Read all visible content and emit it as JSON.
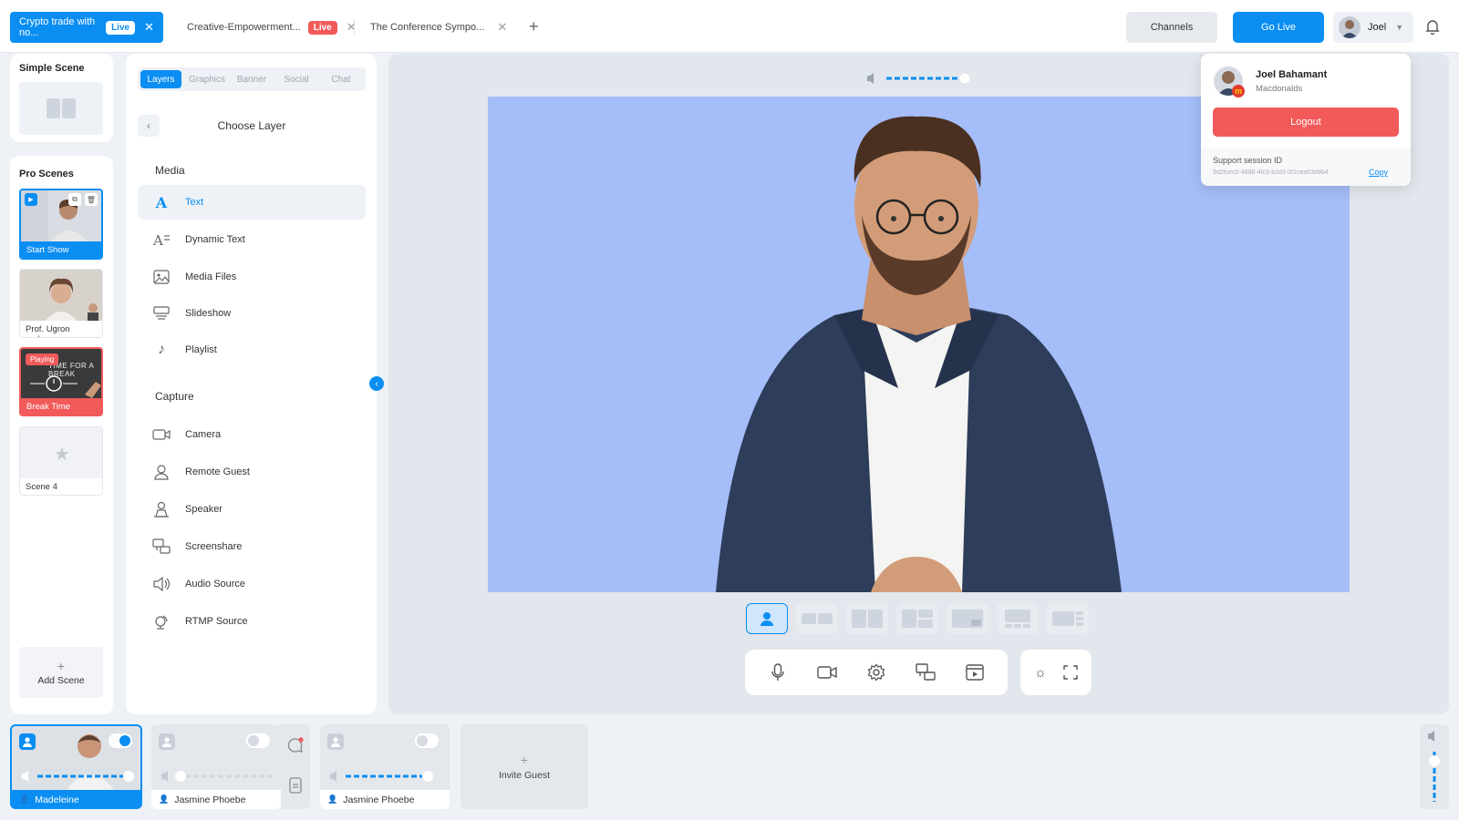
{
  "tabs": [
    {
      "label": "Crypto trade with no...",
      "badge": "Live",
      "active": true
    },
    {
      "label": "Creative-Empowerment...",
      "badge": "Live",
      "active": false
    },
    {
      "label": "The Conference Sympo...",
      "badge": "",
      "active": false
    }
  ],
  "header": {
    "channels": "Channels",
    "go_live": "Go Live",
    "user": "Joel"
  },
  "profile": {
    "name": "Joel Bahamant",
    "org": "Macdonalds",
    "logout": "Logout",
    "session_label": "Support session ID",
    "session_id": "9d2fcec0-4888-4fc3-b2d3-0f1cea53d9b4",
    "copy": "Copy"
  },
  "scenes": {
    "simple_title": "Simple Scene",
    "pro_title": "Pro Scenes",
    "items": [
      {
        "label": "Start Show"
      },
      {
        "label": "Prof. Ugron melo..."
      },
      {
        "label": "Break Time",
        "badge": "Playing",
        "art_text": "TIME FOR A BREAK"
      },
      {
        "label": "Scene 4"
      }
    ],
    "add": "Add Scene"
  },
  "layer_panel": {
    "tabs": [
      "Layers",
      "Graphics",
      "Banner",
      "Social",
      "Chat"
    ],
    "title": "Choose Layer",
    "media_title": "Media",
    "media": [
      {
        "label": "Text",
        "icon": "text-icon"
      },
      {
        "label": "Dynamic Text",
        "icon": "dynamic-text-icon"
      },
      {
        "label": "Media Files",
        "icon": "image-icon"
      },
      {
        "label": "Slideshow",
        "icon": "slideshow-icon"
      },
      {
        "label": "Playlist",
        "icon": "music-note-icon"
      }
    ],
    "capture_title": "Capture",
    "capture": [
      {
        "label": "Camera",
        "icon": "camera-icon"
      },
      {
        "label": "Remote Guest",
        "icon": "remote-guest-icon"
      },
      {
        "label": "Speaker",
        "icon": "speaker-person-icon"
      },
      {
        "label": "Screenshare",
        "icon": "screenshare-icon"
      },
      {
        "label": "Audio Source",
        "icon": "audio-source-icon"
      },
      {
        "label": "RTMP Source",
        "icon": "rtmp-icon"
      }
    ]
  },
  "preview": {
    "volume": 0.82
  },
  "guests": [
    {
      "name": "Madeleine",
      "active": true,
      "toggle_on": true,
      "volume": 0.85
    },
    {
      "name": "Jasmine Phoebe",
      "active": false,
      "toggle_on": false,
      "volume": 0.05
    },
    {
      "name": "Jasmine Phoebe",
      "active": false,
      "toggle_on": false,
      "volume": 0.8
    }
  ],
  "invite_guest": "Invite Guest",
  "colors": {
    "accent": "#0a8ef2",
    "danger": "#f25a5a",
    "preview_bg": "#a5bdf8"
  }
}
